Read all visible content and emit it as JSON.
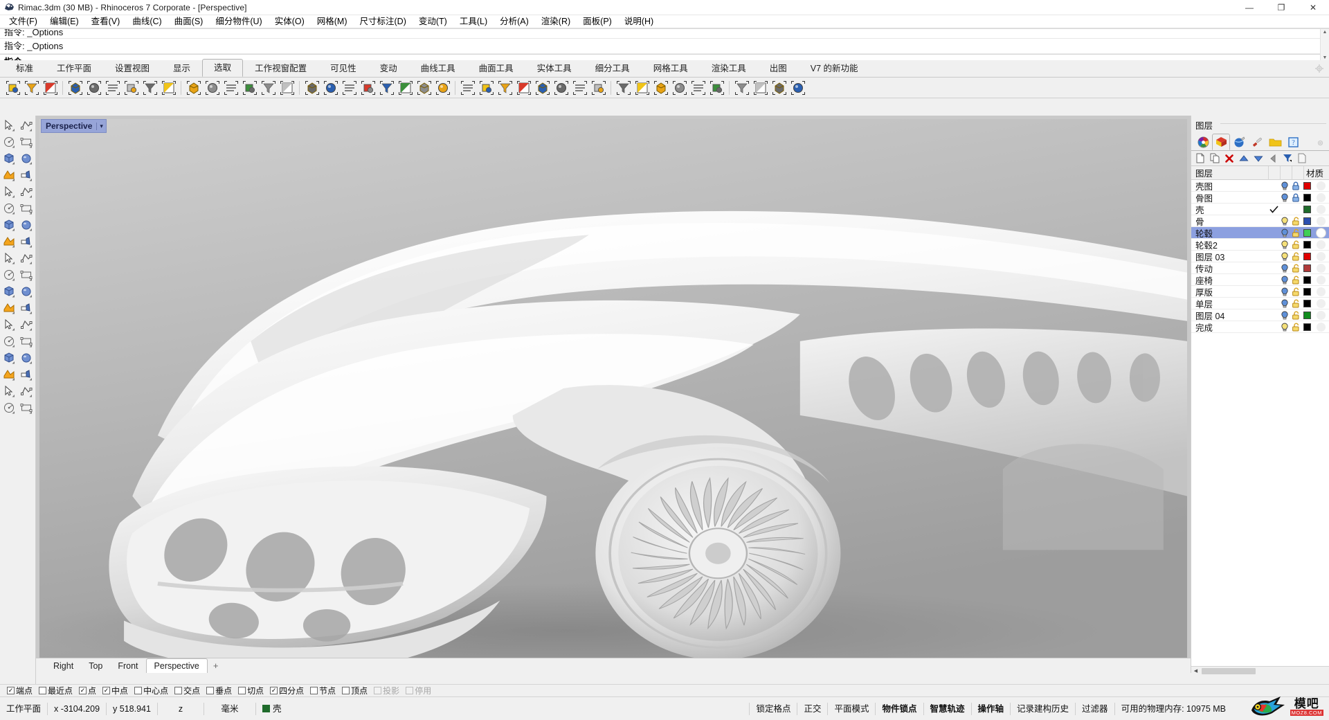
{
  "window": {
    "title": "Rimac.3dm (30 MB) - Rhinoceros 7 Corporate - [Perspective]",
    "app_icon": "rhino-logo-icon",
    "minimize": "—",
    "maximize": "❐",
    "close": "✕"
  },
  "menubar": {
    "items": [
      {
        "label": "文件(F)",
        "name": "menu-file"
      },
      {
        "label": "编辑(E)",
        "name": "menu-edit"
      },
      {
        "label": "查看(V)",
        "name": "menu-view"
      },
      {
        "label": "曲线(C)",
        "name": "menu-curve"
      },
      {
        "label": "曲面(S)",
        "name": "menu-surface"
      },
      {
        "label": "细分物件(U)",
        "name": "menu-subd"
      },
      {
        "label": "实体(O)",
        "name": "menu-solid"
      },
      {
        "label": "网格(M)",
        "name": "menu-mesh"
      },
      {
        "label": "尺寸标注(D)",
        "name": "menu-dimension"
      },
      {
        "label": "变动(T)",
        "name": "menu-transform"
      },
      {
        "label": "工具(L)",
        "name": "menu-tools"
      },
      {
        "label": "分析(A)",
        "name": "menu-analyze"
      },
      {
        "label": "渲染(R)",
        "name": "menu-render"
      },
      {
        "label": "面板(P)",
        "name": "menu-panels"
      },
      {
        "label": "说明(H)",
        "name": "menu-help"
      }
    ]
  },
  "command_area": {
    "history_clipped": "指令: _Options",
    "history": "指令: _Options",
    "prompt": "指令:"
  },
  "toolbar_tabs": {
    "items": [
      {
        "label": "标准"
      },
      {
        "label": "工作平面"
      },
      {
        "label": "设置视图"
      },
      {
        "label": "显示"
      },
      {
        "label": "选取"
      },
      {
        "label": "工作视窗配置"
      },
      {
        "label": "可见性"
      },
      {
        "label": "变动"
      },
      {
        "label": "曲线工具"
      },
      {
        "label": "曲面工具"
      },
      {
        "label": "实体工具"
      },
      {
        "label": "细分工具"
      },
      {
        "label": "网格工具"
      },
      {
        "label": "渲染工具"
      },
      {
        "label": "出图"
      },
      {
        "label": "V7 的新功能"
      }
    ],
    "active": "选取"
  },
  "icon_toolbar": {
    "icons": [
      "select-objects-icon",
      "deselect-objects-icon",
      "select-filter-icon",
      "invert-selection-icon",
      "select-all-icon",
      "select-polysurface-icon",
      "select-previous-icon",
      "select-by-attribute-icon",
      "select-by-id-icon",
      "select-by-layer-icon",
      "select-by-color-icon",
      "select-surface-icon",
      "select-points-icon",
      "select-point-cloud-icon",
      "select-curve-icon",
      "select-group-icon",
      "select-block-icon",
      "select-text-icon",
      "select-annotation-icon",
      "select-hatch-icon",
      "select-light-icon",
      "select-sphere-icon",
      "select-subd-icon",
      "select-mesh-icon",
      "select-box-icon",
      "select-cylinder-icon",
      "select-extrusion-icon",
      "select-dup-border-icon",
      "select-naked-edge-icon",
      "select-circle-icon",
      "select-closed-curve-icon",
      "select-open-curve-icon",
      "select-dupes-icon",
      "select-small-icon",
      "select-chain-icon",
      "select-visible-icon",
      "select-clipping-icon",
      "select-bad-objects-icon",
      "select-last-icon",
      "select-nested-icon",
      "select-crossing-icon"
    ]
  },
  "left_toolbar": {
    "icons": [
      "select-arrow-icon",
      "point-icon",
      "polyline-icon",
      "control-point-curve-icon",
      "circle-center-icon",
      "ellipse-icon",
      "polygon-icon",
      "rectangle-icon",
      "hexagon-icon",
      "arc-icon",
      "surface-from-points-icon",
      "loft-surface-icon",
      "box-icon",
      "sphere-icon",
      "cylinder-icon",
      "surface-grid-icon",
      "boolean-union-icon",
      "explode-icon",
      "trim-icon",
      "split-icon",
      "copy-objects-icon",
      "join-icon",
      "fillet-icon",
      "offset-icon",
      "array-icon",
      "rotate-icon",
      "text-icon",
      "dimension-icon",
      "layers-icon",
      "properties-icon",
      "grid-snap-icon",
      "analysis-icon",
      "render-icon",
      "checkmark-icon",
      "shade-icon",
      "note-icon"
    ]
  },
  "viewport": {
    "label": "Perspective",
    "caret": "▾",
    "tabs": [
      {
        "label": "Right"
      },
      {
        "label": "Top"
      },
      {
        "label": "Front"
      },
      {
        "label": "Perspective"
      }
    ],
    "active_tab": "Perspective",
    "add_tab": "+",
    "scene_description": "Shaded white clay render of a Rimac concept car front three-quarter view"
  },
  "layers_panel": {
    "title": "图层",
    "tabs": [
      {
        "name": "properties-tab",
        "icon": "color-wheel-icon"
      },
      {
        "name": "layers-tab",
        "icon": "layer-stack-icon"
      },
      {
        "name": "display-tab",
        "icon": "globe-icon"
      },
      {
        "name": "materials-tab",
        "icon": "paintbrush-icon"
      },
      {
        "name": "explorer-tab",
        "icon": "folder-icon"
      },
      {
        "name": "help-tab",
        "icon": "help-icon"
      }
    ],
    "active_tab": "layers-tab",
    "gear": "gear-icon",
    "tools": [
      {
        "name": "new-layer-button",
        "icon": "new-page-icon"
      },
      {
        "name": "duplicate-layer-button",
        "icon": "copy-page-icon"
      },
      {
        "name": "delete-layer-button",
        "icon": "red-x-icon"
      },
      {
        "name": "move-up-button",
        "icon": "triangle-up-icon"
      },
      {
        "name": "move-down-button",
        "icon": "triangle-down-icon"
      },
      {
        "name": "move-left-button",
        "icon": "triangle-left-icon"
      },
      {
        "name": "filter-button",
        "icon": "funnel-icon"
      },
      {
        "name": "layer-properties-button",
        "icon": "page-icon"
      }
    ],
    "columns": {
      "name": "图层",
      "material": "材质"
    },
    "rows": [
      {
        "name": "壳图",
        "current": false,
        "visible": true,
        "bulb": "blue",
        "locked": true,
        "color": "#e00000",
        "material": "off"
      },
      {
        "name": "骨图",
        "current": false,
        "visible": true,
        "bulb": "blue",
        "locked": true,
        "color": "#000000",
        "material": "off"
      },
      {
        "name": "壳",
        "current": true,
        "visible": null,
        "bulb": "none",
        "locked": null,
        "color": "#1f6b2b",
        "material": "off"
      },
      {
        "name": "骨",
        "current": false,
        "visible": true,
        "bulb": "yellow",
        "locked": false,
        "color": "#2b4fb0",
        "material": "off"
      },
      {
        "name": "轮毂",
        "current": false,
        "visible": true,
        "bulb": "blue",
        "locked": false,
        "color": "#3fcf57",
        "material": "on",
        "selected": true
      },
      {
        "name": "轮毂2",
        "current": false,
        "visible": true,
        "bulb": "yellow",
        "locked": false,
        "color": "#000000",
        "material": "off"
      },
      {
        "name": "图层 03",
        "current": false,
        "visible": true,
        "bulb": "yellow",
        "locked": false,
        "color": "#e00000",
        "material": "off"
      },
      {
        "name": "传动",
        "current": false,
        "visible": true,
        "bulb": "blue",
        "locked": false,
        "color": "#b03a3a",
        "material": "off"
      },
      {
        "name": "座椅",
        "current": false,
        "visible": true,
        "bulb": "blue",
        "locked": false,
        "color": "#000000",
        "material": "off"
      },
      {
        "name": "厚版",
        "current": false,
        "visible": true,
        "bulb": "blue",
        "locked": false,
        "color": "#000000",
        "material": "off"
      },
      {
        "name": "单层",
        "current": false,
        "visible": true,
        "bulb": "blue",
        "locked": false,
        "color": "#000000",
        "material": "off"
      },
      {
        "name": "图层 04",
        "current": false,
        "visible": true,
        "bulb": "blue",
        "locked": false,
        "color": "#118c1e",
        "material": "off"
      },
      {
        "name": "完成",
        "current": false,
        "visible": true,
        "bulb": "yellow",
        "locked": false,
        "color": "#000000",
        "material": "off"
      }
    ]
  },
  "osnap_bar": {
    "items": [
      {
        "label": "端点",
        "checked": true,
        "enabled": true
      },
      {
        "label": "最近点",
        "checked": false,
        "enabled": true
      },
      {
        "label": "点",
        "checked": true,
        "enabled": true
      },
      {
        "label": "中点",
        "checked": true,
        "enabled": true
      },
      {
        "label": "中心点",
        "checked": false,
        "enabled": true
      },
      {
        "label": "交点",
        "checked": false,
        "enabled": true
      },
      {
        "label": "垂点",
        "checked": false,
        "enabled": true
      },
      {
        "label": "切点",
        "checked": false,
        "enabled": true
      },
      {
        "label": "四分点",
        "checked": true,
        "enabled": true
      },
      {
        "label": "节点",
        "checked": false,
        "enabled": true
      },
      {
        "label": "顶点",
        "checked": false,
        "enabled": true
      },
      {
        "label": "投影",
        "checked": false,
        "enabled": false
      },
      {
        "label": "停用",
        "checked": false,
        "enabled": false
      }
    ]
  },
  "status_bar": {
    "cplane": "工作平面",
    "x_label": "x -3104.209",
    "y_label": "y 518.941",
    "z_label": "z",
    "units": "毫米",
    "layer_color": "#1f6b2b",
    "layer_name": "壳",
    "toggles": [
      {
        "label": "锁定格点",
        "active": false
      },
      {
        "label": "正交",
        "active": false
      },
      {
        "label": "平面模式",
        "active": false
      },
      {
        "label": "物件锁点",
        "active": true
      },
      {
        "label": "智慧轨迹",
        "active": true
      },
      {
        "label": "操作轴",
        "active": true
      },
      {
        "label": "记录建构历史",
        "active": false
      },
      {
        "label": "过滤器",
        "active": false
      }
    ],
    "memory": "可用的物理内存: 10975 MB"
  },
  "watermark": {
    "text_cn": "模吧",
    "url": "MOZ8.COM",
    "icon": "bird-logo-icon"
  }
}
